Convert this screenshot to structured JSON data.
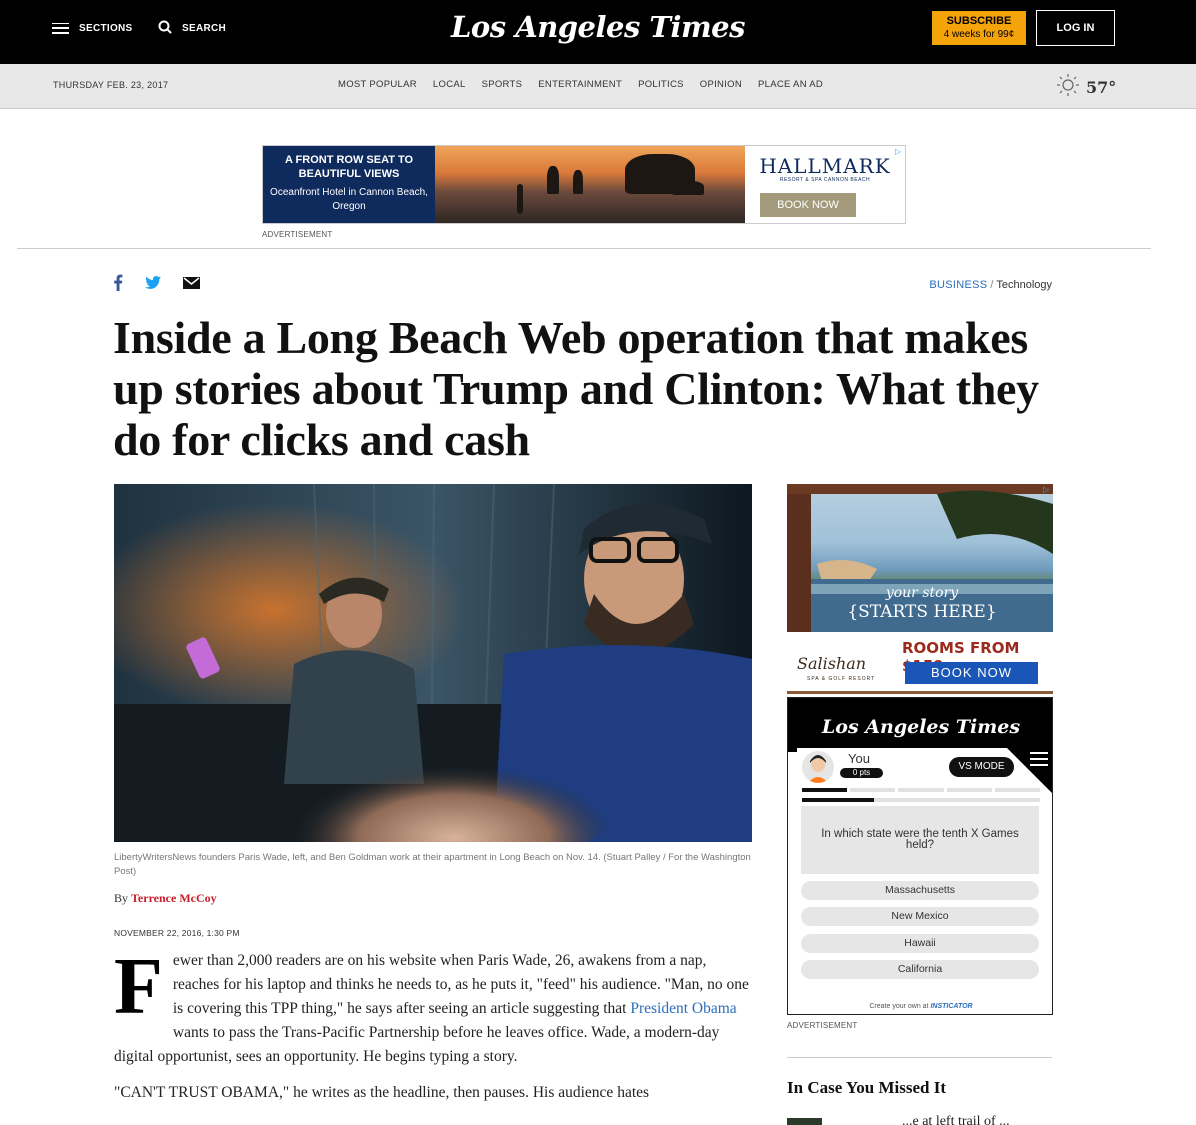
{
  "header": {
    "sections_label": "SECTIONS",
    "search_label": "SEARCH",
    "logo": "Los Angeles Times",
    "subscribe": "SUBSCRIBE",
    "subscribe_offer": "4 weeks for 99¢",
    "login": "LOG IN"
  },
  "subnav": {
    "date": "THURSDAY FEB. 23, 2017",
    "items": [
      "MOST POPULAR",
      "LOCAL",
      "SPORTS",
      "ENTERTAINMENT",
      "POLITICS",
      "OPINION",
      "PLACE AN AD"
    ],
    "weather_temp": "57°",
    "weather_icon": "sun-icon"
  },
  "top_ad": {
    "headline": "A FRONT ROW SEAT TO BEAUTIFUL VIEWS",
    "text": "Oceanfront Hotel in Cannon Beach, Oregon",
    "brand": "HALLMARK",
    "brand_sub": "RESORT & SPA CANNON BEACH",
    "cta": "BOOK NOW",
    "label": "ADVERTISEMENT"
  },
  "article": {
    "share_icons": [
      "facebook-icon",
      "twitter-icon",
      "email-icon"
    ],
    "section": "BUSINESS",
    "separator": "/",
    "subsection": "Technology",
    "headline": "Inside a Long Beach Web operation that makes up stories about Trump and Clinton: What they do for clicks and cash",
    "caption": "LibertyWritersNews founders Paris Wade, left, and Ben Goldman work at their apartment in Long Beach on Nov. 14. (Stuart Palley / For the Washington Post)",
    "by": "By",
    "author": "Terrence McCoy",
    "date": "NOVEMBER 22, 2016, 1:30 PM",
    "dropcap": "F",
    "p1_before": "ewer than 2,000 readers are on his website when Paris Wade, 26, awakens from a nap, reaches for his laptop and thinks he needs to, as he puts it, \"feed\" his audience. \"Man, no one is covering this TPP thing,\" he says after seeing an article suggesting that",
    "p1_link": "President Obama",
    "p1_after": "wants to pass the Trans-Pacific Partnership before he leaves office. Wade, a modern-day digital opportunist, sees an opportunity. He begins typing a story.",
    "p2": "\"CAN'T TRUST OBAMA,\" he writes as the headline, then pauses. His audience hates"
  },
  "right_ad": {
    "story_line1": "your story",
    "story_line2": "{STARTS HERE}",
    "brand": "Salishan",
    "brand_sub": "SPA & GOLF RESORT",
    "price": "ROOMS FROM $159",
    "cta": "BOOK NOW",
    "label": "ADVERTISEMENT"
  },
  "quiz": {
    "logo": "Los Angeles Times",
    "you": "You",
    "points": "0 pts",
    "vs_mode": "VS MODE",
    "question": "In which state were the tenth X Games held?",
    "answers": [
      "Massachusetts",
      "New Mexico",
      "Hawaii",
      "California"
    ],
    "credit_prefix": "Create your own at",
    "credit_brand": "INSTICATOR"
  },
  "rail": {
    "missed_title": "In Case You Missed It",
    "missed_text": "...e at left trail of ..."
  }
}
